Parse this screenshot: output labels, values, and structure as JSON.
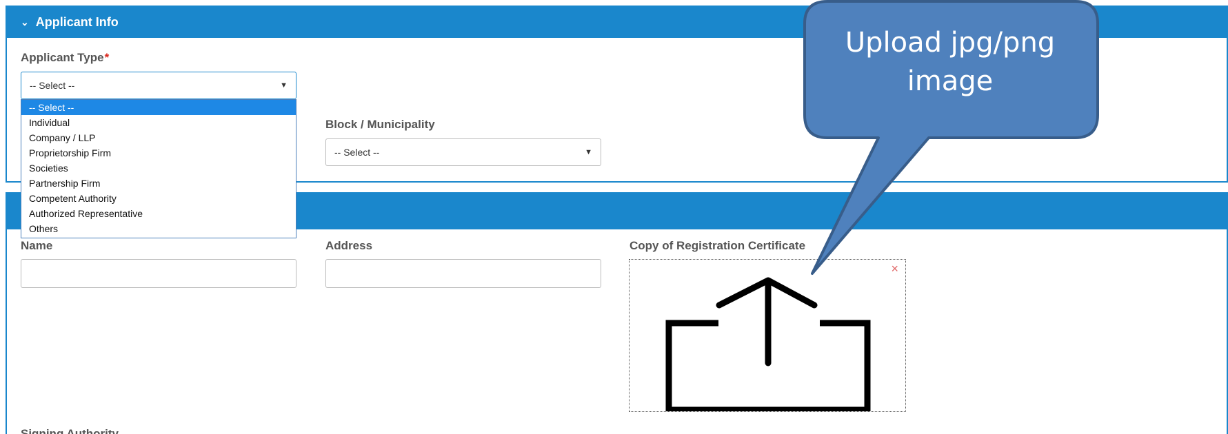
{
  "applicant_section": {
    "title": "Applicant Info",
    "applicant_type_label": "Applicant Type",
    "required_mark": "*",
    "applicant_type_value": "-- Select --",
    "block_label": "Block / Municipality",
    "block_value": "-- Select --",
    "dropdown_options": [
      "-- Select --",
      "Individual",
      "Company / LLP",
      "Proprietorship Firm",
      "Societies",
      "Partnership Firm",
      "Competent Authority",
      "Authorized Representative",
      "Others"
    ],
    "selected_option": "-- Select --"
  },
  "details_section": {
    "name_label": "Name",
    "address_label": "Address",
    "certificate_label": "Copy of Registration Certificate",
    "close_glyph": "×",
    "signing_label": "Signing Authority"
  },
  "callout": {
    "text_line1": "Upload jpg/png",
    "text_line2": "image"
  },
  "colors": {
    "header_blue": "#1a87cc",
    "callout_blue": "#4f81bd",
    "callout_border": "#385d8a",
    "selected_option_bg": "#1e88e5",
    "required_red": "#d9261c"
  },
  "icons": {
    "section_toggle": "chevron-down-icon",
    "select_arrow": "triangle-down-icon",
    "upload": "upload-icon",
    "remove": "close-icon"
  }
}
